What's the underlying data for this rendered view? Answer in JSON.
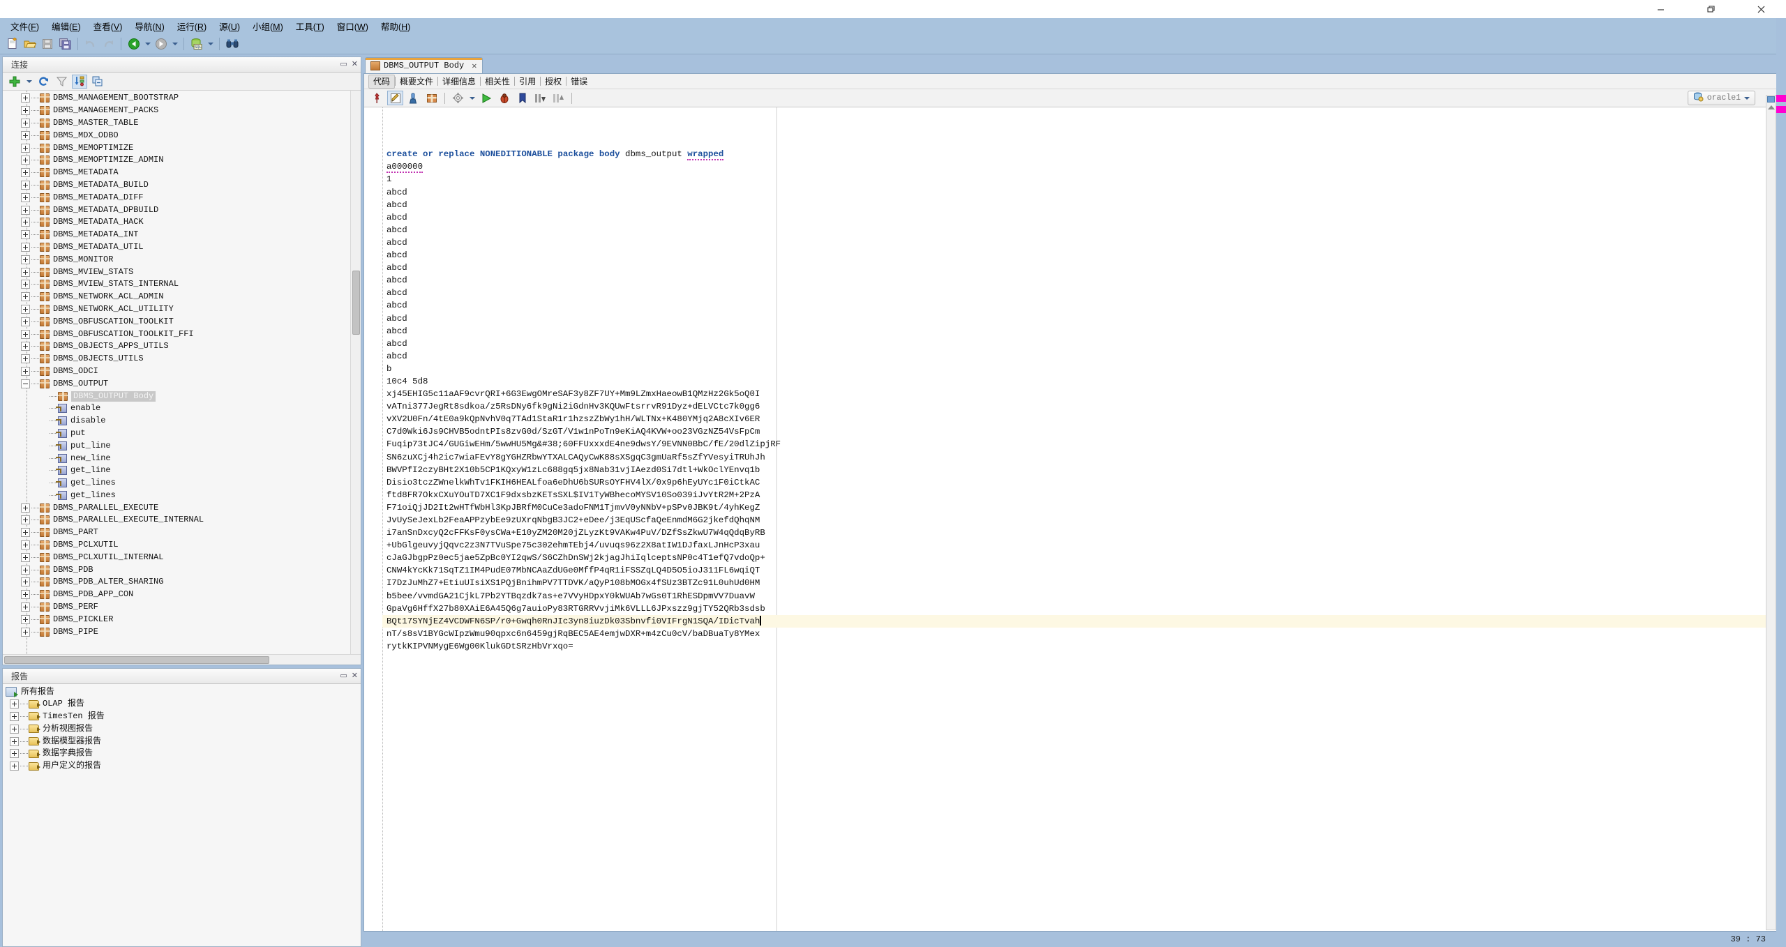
{
  "window": {
    "buttons": {
      "minimize": "—",
      "maximize": "❐",
      "close": "✕"
    }
  },
  "menubar": {
    "items": [
      {
        "label": "文件",
        "mnemonic": "F"
      },
      {
        "label": "编辑",
        "mnemonic": "E"
      },
      {
        "label": "查看",
        "mnemonic": "V"
      },
      {
        "label": "导航",
        "mnemonic": "N"
      },
      {
        "label": "运行",
        "mnemonic": "R"
      },
      {
        "label": "源",
        "mnemonic": "U"
      },
      {
        "label": "小组",
        "mnemonic": "M"
      },
      {
        "label": "工具",
        "mnemonic": "T"
      },
      {
        "label": "窗口",
        "mnemonic": "W"
      },
      {
        "label": "帮助",
        "mnemonic": "H"
      }
    ]
  },
  "toolbar": {
    "icons": [
      "new-file-icon",
      "open-folder-icon",
      "save-icon",
      "save-all-icon",
      "undo-icon",
      "redo-icon",
      "navigate-back-icon",
      "navigate-forward-icon",
      "run-sql-icon",
      "find-binoculars-icon"
    ]
  },
  "connections_panel": {
    "title": "连接",
    "toolbar_icons": [
      "add-connection-icon",
      "add-connection-dropdown-icon",
      "refresh-icon",
      "filter-icon",
      "sort-icon",
      "collapse-all-icon"
    ],
    "tree": [
      {
        "label": "DBMS_MANAGEMENT_BOOTSTRAP",
        "icon": "package-icon",
        "state": "collapsed",
        "depth": 0
      },
      {
        "label": "DBMS_MANAGEMENT_PACKS",
        "icon": "package-icon",
        "state": "collapsed",
        "depth": 0
      },
      {
        "label": "DBMS_MASTER_TABLE",
        "icon": "package-icon",
        "state": "collapsed",
        "depth": 0
      },
      {
        "label": "DBMS_MDX_ODBO",
        "icon": "package-icon",
        "state": "collapsed",
        "depth": 0
      },
      {
        "label": "DBMS_MEMOPTIMIZE",
        "icon": "package-icon",
        "state": "collapsed",
        "depth": 0
      },
      {
        "label": "DBMS_MEMOPTIMIZE_ADMIN",
        "icon": "package-icon",
        "state": "collapsed",
        "depth": 0
      },
      {
        "label": "DBMS_METADATA",
        "icon": "package-icon",
        "state": "collapsed",
        "depth": 0
      },
      {
        "label": "DBMS_METADATA_BUILD",
        "icon": "package-icon",
        "state": "collapsed",
        "depth": 0
      },
      {
        "label": "DBMS_METADATA_DIFF",
        "icon": "package-icon",
        "state": "collapsed",
        "depth": 0
      },
      {
        "label": "DBMS_METADATA_DPBUILD",
        "icon": "package-icon",
        "state": "collapsed",
        "depth": 0
      },
      {
        "label": "DBMS_METADATA_HACK",
        "icon": "package-icon",
        "state": "collapsed",
        "depth": 0
      },
      {
        "label": "DBMS_METADATA_INT",
        "icon": "package-icon",
        "state": "collapsed",
        "depth": 0
      },
      {
        "label": "DBMS_METADATA_UTIL",
        "icon": "package-icon",
        "state": "collapsed",
        "depth": 0
      },
      {
        "label": "DBMS_MONITOR",
        "icon": "package-icon",
        "state": "collapsed",
        "depth": 0
      },
      {
        "label": "DBMS_MVIEW_STATS",
        "icon": "package-icon",
        "state": "collapsed",
        "depth": 0
      },
      {
        "label": "DBMS_MVIEW_STATS_INTERNAL",
        "icon": "package-icon",
        "state": "collapsed",
        "depth": 0
      },
      {
        "label": "DBMS_NETWORK_ACL_ADMIN",
        "icon": "package-icon",
        "state": "collapsed",
        "depth": 0
      },
      {
        "label": "DBMS_NETWORK_ACL_UTILITY",
        "icon": "package-icon",
        "state": "collapsed",
        "depth": 0
      },
      {
        "label": "DBMS_OBFUSCATION_TOOLKIT",
        "icon": "package-icon",
        "state": "collapsed",
        "depth": 0
      },
      {
        "label": "DBMS_OBFUSCATION_TOOLKIT_FFI",
        "icon": "package-icon",
        "state": "collapsed",
        "depth": 0
      },
      {
        "label": "DBMS_OBJECTS_APPS_UTILS",
        "icon": "package-icon",
        "state": "collapsed",
        "depth": 0
      },
      {
        "label": "DBMS_OBJECTS_UTILS",
        "icon": "package-icon",
        "state": "collapsed",
        "depth": 0
      },
      {
        "label": "DBMS_ODCI",
        "icon": "package-icon",
        "state": "collapsed",
        "depth": 0
      },
      {
        "label": "DBMS_OUTPUT",
        "icon": "package-icon",
        "state": "expanded",
        "depth": 0
      },
      {
        "label": "DBMS_OUTPUT Body",
        "icon": "package-icon",
        "state": "leaf",
        "depth": 1,
        "selected": true
      },
      {
        "label": "enable",
        "icon": "procedure-icon",
        "state": "leaf",
        "depth": 1
      },
      {
        "label": "disable",
        "icon": "procedure-icon",
        "state": "leaf",
        "depth": 1
      },
      {
        "label": "put",
        "icon": "procedure-icon",
        "state": "leaf",
        "depth": 1
      },
      {
        "label": "put_line",
        "icon": "procedure-icon",
        "state": "leaf",
        "depth": 1
      },
      {
        "label": "new_line",
        "icon": "procedure-icon",
        "state": "leaf",
        "depth": 1
      },
      {
        "label": "get_line",
        "icon": "procedure-icon",
        "state": "leaf",
        "depth": 1
      },
      {
        "label": "get_lines",
        "icon": "procedure-icon",
        "state": "leaf",
        "depth": 1
      },
      {
        "label": "get_lines",
        "icon": "procedure-icon",
        "state": "leaf",
        "depth": 1
      },
      {
        "label": "DBMS_PARALLEL_EXECUTE",
        "icon": "package-icon",
        "state": "collapsed",
        "depth": 0
      },
      {
        "label": "DBMS_PARALLEL_EXECUTE_INTERNAL",
        "icon": "package-icon",
        "state": "collapsed",
        "depth": 0
      },
      {
        "label": "DBMS_PART",
        "icon": "package-icon",
        "state": "collapsed",
        "depth": 0
      },
      {
        "label": "DBMS_PCLXUTIL",
        "icon": "package-icon",
        "state": "collapsed",
        "depth": 0
      },
      {
        "label": "DBMS_PCLXUTIL_INTERNAL",
        "icon": "package-icon",
        "state": "collapsed",
        "depth": 0
      },
      {
        "label": "DBMS_PDB",
        "icon": "package-icon",
        "state": "collapsed",
        "depth": 0
      },
      {
        "label": "DBMS_PDB_ALTER_SHARING",
        "icon": "package-icon",
        "state": "collapsed",
        "depth": 0
      },
      {
        "label": "DBMS_PDB_APP_CON",
        "icon": "package-icon",
        "state": "collapsed",
        "depth": 0
      },
      {
        "label": "DBMS_PERF",
        "icon": "package-icon",
        "state": "collapsed",
        "depth": 0
      },
      {
        "label": "DBMS_PICKLER",
        "icon": "package-icon",
        "state": "collapsed",
        "depth": 0
      },
      {
        "label": "DBMS_PIPE",
        "icon": "package-icon",
        "state": "collapsed",
        "depth": 0
      }
    ]
  },
  "reports_panel": {
    "title": "报告",
    "tree": [
      {
        "label": "所有报告",
        "icon": "all-reports-icon",
        "state": "root",
        "depth": 0
      },
      {
        "label": "OLAP 报告",
        "icon": "folder-icon",
        "state": "collapsed",
        "depth": 1
      },
      {
        "label": "TimesTen 报告",
        "icon": "folder-icon",
        "state": "collapsed",
        "depth": 1
      },
      {
        "label": "分析视图报告",
        "icon": "folder-icon",
        "state": "collapsed",
        "depth": 1
      },
      {
        "label": "数据模型器报告",
        "icon": "folder-icon",
        "state": "collapsed",
        "depth": 1
      },
      {
        "label": "数据字典报告",
        "icon": "folder-icon",
        "state": "collapsed",
        "depth": 1
      },
      {
        "label": "用户定义的报告",
        "icon": "folder-icon",
        "state": "collapsed",
        "depth": 1
      }
    ]
  },
  "editor": {
    "tab": {
      "label": "DBMS_OUTPUT Body",
      "icon": "package-icon",
      "close": "✕"
    },
    "subtabs": [
      {
        "label": "代码",
        "active": true
      },
      {
        "label": "概要文件",
        "active": false
      },
      {
        "label": "详细信息",
        "active": false
      },
      {
        "label": "相关性",
        "active": false
      },
      {
        "label": "引用",
        "active": false
      },
      {
        "label": "授权",
        "active": false
      },
      {
        "label": "错误",
        "active": false
      }
    ],
    "toolbar_icons": [
      "pin-icon",
      "edit-icon",
      "inspect-icon",
      "package-icon",
      "compile-gear-icon",
      "compile-dropdown-icon",
      "run-icon",
      "debug-bug-icon",
      "bookmark-icon",
      "step-down-icon",
      "step-up-icon"
    ],
    "connection": {
      "label": "oracle1",
      "icon": "database-icon",
      "dropdown": "chevron-down-icon"
    },
    "status": {
      "caret": "39 : 73"
    },
    "code_lines": [
      {
        "type": "header",
        "segments": [
          {
            "text": "create or replace ",
            "style": "kw"
          },
          {
            "text": "NONEDITIONABLE",
            "style": "kw"
          },
          {
            "text": " ",
            "style": "plain"
          },
          {
            "text": "package body",
            "style": "kw"
          },
          {
            "text": " dbms_output ",
            "style": "plain"
          },
          {
            "text": "wrapped",
            "style": "kw-squig"
          }
        ]
      },
      {
        "type": "plain",
        "text": "a000000",
        "squiggle": true
      },
      {
        "type": "plain",
        "text": "1"
      },
      {
        "type": "plain",
        "text": "abcd"
      },
      {
        "type": "plain",
        "text": "abcd"
      },
      {
        "type": "plain",
        "text": "abcd"
      },
      {
        "type": "plain",
        "text": "abcd"
      },
      {
        "type": "plain",
        "text": "abcd"
      },
      {
        "type": "plain",
        "text": "abcd"
      },
      {
        "type": "plain",
        "text": "abcd"
      },
      {
        "type": "plain",
        "text": "abcd"
      },
      {
        "type": "plain",
        "text": "abcd"
      },
      {
        "type": "plain",
        "text": "abcd"
      },
      {
        "type": "plain",
        "text": "abcd"
      },
      {
        "type": "plain",
        "text": "abcd"
      },
      {
        "type": "plain",
        "text": "abcd"
      },
      {
        "type": "plain",
        "text": "abcd"
      },
      {
        "type": "plain",
        "text": "b"
      },
      {
        "type": "plain",
        "text": "10c4 5d8"
      },
      {
        "type": "plain",
        "text": "xj45EHIG5c11aAF9cvrQRI+6G3EwgOMreSAF3y8ZF7UY+Mm9LZmxHaeowB1QMzHz2Gk5oQ0I"
      },
      {
        "type": "plain",
        "text": "vATni377JegRt8sdkoa/z5RsDNy6fk9gNi2iGdnHv3KQUwFtsrrvR91Dyz+dELVCtc7k0gg6"
      },
      {
        "type": "plain",
        "text": "vXV2U0Fn/4tE0a9kQpNvhV0q7TAd1StaR1r1hzszZbWy1hH/WLTNx+K480YMjq2A8cXIv6ER"
      },
      {
        "type": "plain",
        "text": "C7d0Wki6Js9CHVB5odntPIs8zvG0d/SzGT/V1w1nPoTn9eKiAQ4KVW+oo23VGzNZ54VsFpCm"
      },
      {
        "type": "plain",
        "text": "Fuqip73tJC4/GUGiwEHm/5wwHU5Mg&#38;60FFUxxxdE4ne9dwsY/9EVNN0BbC/fE/20dlZipjRF"
      },
      {
        "type": "plain",
        "text": "SN6zuXCj4h2ic7wiaFEvY8gYGHZRbwYTXALCAQyCwK88sXSgqC3gmUaRf5sZfYVesyiTRUhJh"
      },
      {
        "type": "plain",
        "text": "BWVPfI2czyBHt2X10b5CP1KQxyW1zLc688gq5jx8Nab31vjIAezd0Si7dtl+WkOclYEnvq1b"
      },
      {
        "type": "plain",
        "text": "Disio3tczZWnelkWhTv1FKIH6HEALfoa6eDhU6bSURsOYFHV4lX/0x9p6hEyUYc1F0iCtkAC"
      },
      {
        "type": "plain",
        "text": "ftd8FR7OkxCXuYOuTD7XC1F9dxsbzKETsSXL$IV1TyWBhecoMYSV10So039iJvYtR2M+2PzA"
      },
      {
        "type": "plain",
        "text": "F71oiQjJD2It2wHTfWbHl3KpJBRfM0CuCe3adoFNM1TjmvV0yNNbV+pSPv0JBK9t/4yhKegZ"
      },
      {
        "type": "plain",
        "text": "JvUySeJexLb2FeaAPPzybEe9zUXrqNbgB3JC2+eDee/j3EqUScfaQeEnmdM6G2jkefdQhqNM"
      },
      {
        "type": "plain",
        "text": "i7anSnDxcyQ2cFFKsF0ysCWa+E10yZM20M20jZLyzKt9VAKw4PuV/DZfSsZkwU7W4qQdqByRB"
      },
      {
        "type": "plain",
        "text": "+UbGlgeuvyjQqvc2z3N7TVuSpe75c302ehmTEbj4/uvuqs96z2X8atIW1DJfaxLJnHcP3xau"
      },
      {
        "type": "plain",
        "text": "cJaGJbgpPz0ec5jae5ZpBc0YI2qwS/S6CZhDnSWj2kjagJhiIqlceptsNP0c4T1efQ7vdoQp+"
      },
      {
        "type": "plain",
        "text": "CNW4kYcKk71SqTZ1IM4PudE07MbNCAaZdUGe0MffP4qR1iFSSZqLQ4D5O5ioJ311FL6wqiQT"
      },
      {
        "type": "plain",
        "text": "I7DzJuMhZ7+EtiuUIsiXS1PQjBnihmPV7TTDVK/aQyP108bMOGx4fSUz3BTZc91L0uhUd0HM"
      },
      {
        "type": "plain",
        "text": "b5bee/vvmdGA21CjkL7Pb2YTBqzdk7as+e7VVyHDpxY0kWUAb7wGs0T1RhESDpmVV7DuavW"
      },
      {
        "type": "plain",
        "text": "GpaVg6HffX27b80XAiE6A45Q6g7auioPy83RTGRRVvjiMk6VLLL6JPxszz9gjTY52QRb3sdsb"
      },
      {
        "type": "plain",
        "text": "BQt17SYNjEZ4VCDWFN6SP/r0+Gwqh0RnJIc3yn8iuzDk03Sbnvfi0VIFrgN1SQA/IDicTvah",
        "highlight": true,
        "caret": true
      },
      {
        "type": "plain",
        "text": "nT/s8sV1BYGcWIpzWmu90qpxc6n6459gjRqBEC5AE4emjwDXR+m4zCu0cV/baDBuaTy8YMex"
      },
      {
        "type": "plain",
        "text": "rytkKIPVNMygE6Wg00KlukGDtSRzHbVrxqo="
      }
    ]
  }
}
